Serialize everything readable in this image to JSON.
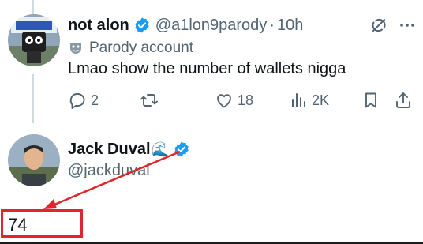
{
  "tweet": {
    "author": {
      "display_name": "not alon",
      "handle": "@a1lon9parody",
      "verified": true,
      "avatar": "avatar-not-alon"
    },
    "separator": "·",
    "time": "10h",
    "label": "Parody account",
    "label_icon": "mask-icon",
    "text": "Lmao show the number of wallets nigga",
    "actions": {
      "replies": "2",
      "reposts": "",
      "likes": "18",
      "views": "2K"
    },
    "header_icons": [
      "grok-icon",
      "more-icon"
    ]
  },
  "reply": {
    "author": {
      "display_name": "Jack Duval",
      "display_emoji": "🌊",
      "handle": "@jackduval",
      "verified": true,
      "avatar": "avatar-jack-duval"
    }
  },
  "annotation": {
    "value": "74",
    "color": "#e0252b"
  },
  "colors": {
    "text_primary": "#0f1419",
    "text_secondary": "#536471",
    "verified_blue": "#1d9bf0",
    "thread_line": "#cfd9de"
  }
}
